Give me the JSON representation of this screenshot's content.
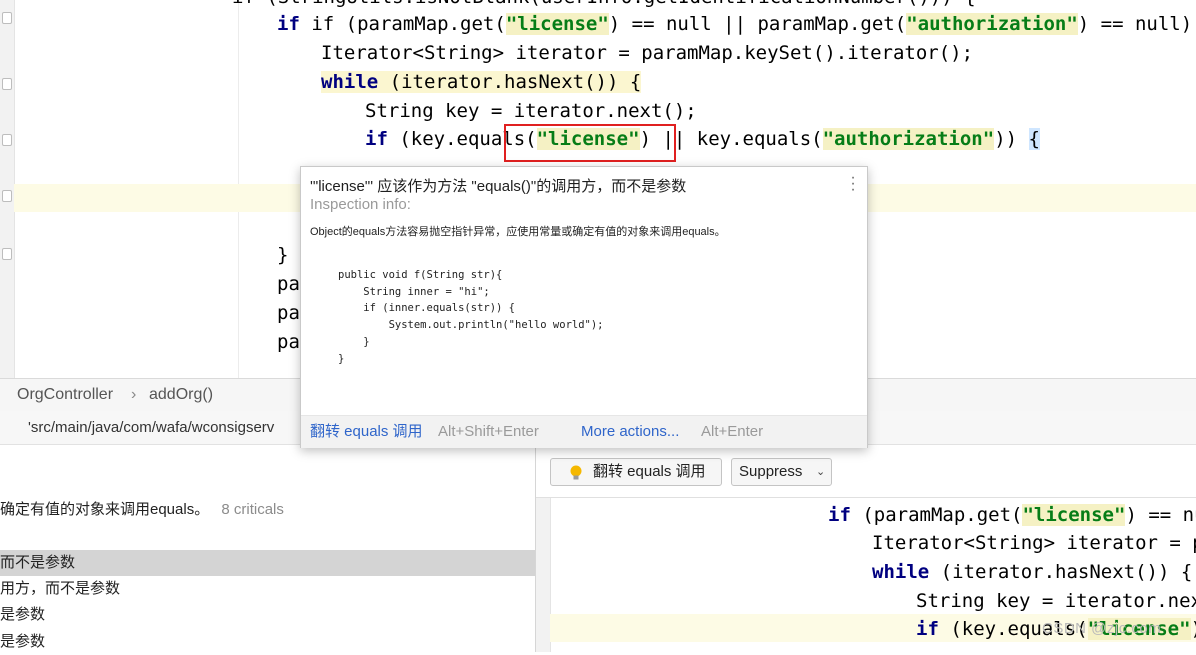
{
  "editor": {
    "lines": {
      "l1": {
        "a": "if (paramMap.get(",
        "b": "\"license\"",
        "c": ") == null || paramMap.get(",
        "d": "\"authorization\"",
        "e": ") == null) {"
      },
      "l2": {
        "a": "Iterator<String> iterator = paramMap.keySet().iterator();"
      },
      "l3": {
        "kw": "while",
        "a": " (iterator.hasNext()) {"
      },
      "l4": {
        "a": "String key = iterator.next();"
      },
      "l5": {
        "kw": "if",
        "a": " (key.equa",
        "a2": "ls(",
        "b": "\"license\"",
        "c": ") || key.equals(",
        "d": "\"authorization\"",
        "e": ")) ",
        "f": "{"
      },
      "l6": {
        "a": "}"
      },
      "l7": {
        "a": "pa"
      },
      "l8": {
        "a": "pa"
      },
      "l9": {
        "a": "pa"
      }
    }
  },
  "breadcrumb": {
    "items": [
      "OrgController",
      "addOrg()"
    ]
  },
  "pathbar": {
    "path": "'src/main/java/com/wafa/wconsigserv"
  },
  "popup": {
    "title": "'\"license\"' 应该作为方法 \"equals()\"的调用方，而不是参数",
    "subtitle": "Inspection info:",
    "description": "Object的equals方法容易抛空指针异常，应使用常量或确定有值的对象来调用equals。",
    "code": "public void f(String str){\n    String inner = \"hi\";\n    if (inner.equals(str)) {\n        System.out.println(\"hello world\");\n    }\n}",
    "fix_label": "翻转 equals 调用",
    "fix_shortcut": "Alt+Shift+Enter",
    "more_label": "More actions...",
    "more_shortcut": "Alt+Enter"
  },
  "results": {
    "summary": "确定有值的对象来调用equals。",
    "count": "8 criticals",
    "items": [
      "而不是参数",
      "用方，而不是参数",
      "是参数",
      "是参数"
    ]
  },
  "preview": {
    "flip_button": "翻转 equals 调用",
    "suppress_button": "Suppress",
    "lines": {
      "l1": {
        "kw": "if",
        "a": " (paramMap.get(",
        "b": "\"license\"",
        "c": ") == nul"
      },
      "l2": {
        "a": "Iterator<String> iterator = pa"
      },
      "l3": {
        "kw": "while",
        "a": " (iterator.hasNext()) {"
      },
      "l4": {
        "a": "String key = iterator.next"
      },
      "l5": {
        "kw": "if",
        "a": " (key.equals(",
        "b": "\"license\"",
        "c": ")"
      }
    }
  },
  "watermark": "CSDN @zjc.com",
  "colors": {
    "keyword": "#000080",
    "string": "#067d17",
    "link": "#2f65ca",
    "error_box": "#e02020"
  }
}
